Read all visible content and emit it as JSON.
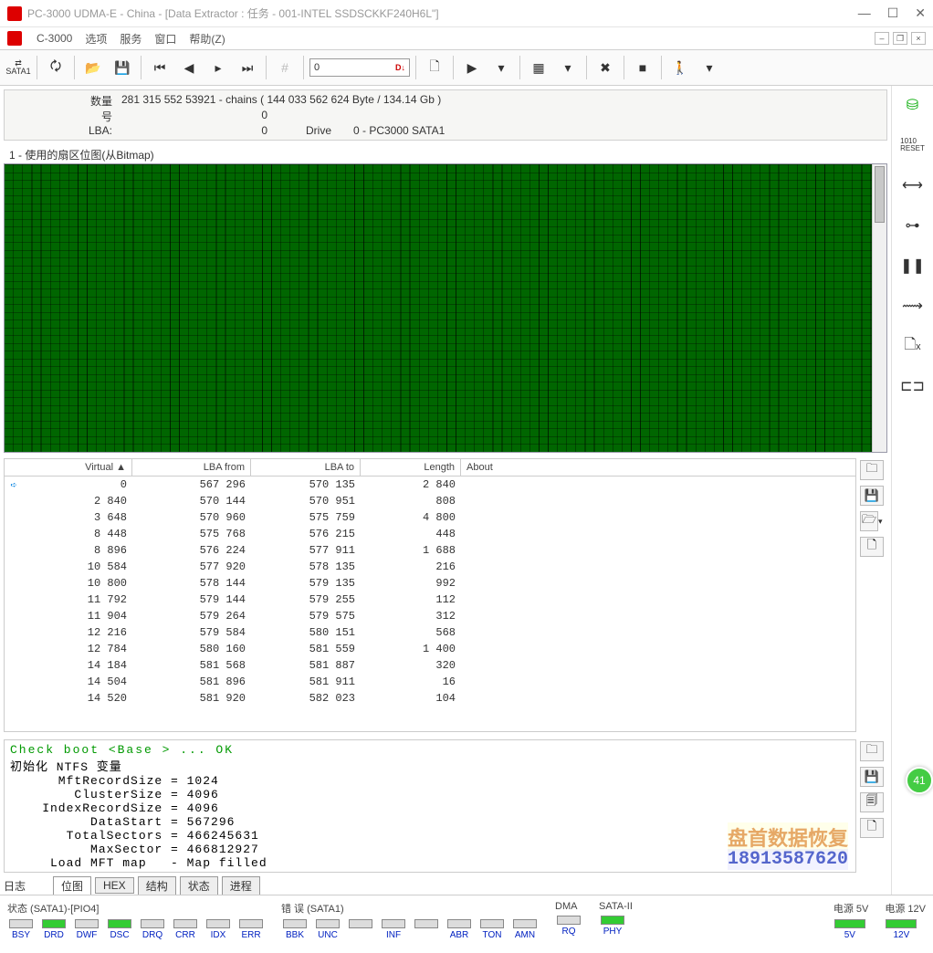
{
  "window": {
    "title": "PC-3000 UDMA-E - China - [Data Extractor : 任务 -           001-INTEL SSDSCKKF240H6L\"]",
    "btn_min": "—",
    "btn_max": "☐",
    "btn_close": "✕"
  },
  "menu": {
    "app": "C-3000",
    "options": "选项",
    "service": "服务",
    "window": "窗口",
    "help": "帮助(Z)"
  },
  "toolbar": {
    "sata": "SATA1",
    "lba_value": "0",
    "lba_suffix": "D↓"
  },
  "info": {
    "qty_label": "数量",
    "qty_value": "281 315 552   53921 - chains   ( 144 033 562 624 Byte /   134.14 Gb )",
    "hao_label": "号",
    "hao_value": "0",
    "lba_label": "LBA:",
    "lba_value": "0",
    "drive_label": "Drive",
    "drive_value": "0 - PC3000 SATA1"
  },
  "bitmap": {
    "title": "1 - 使用的扇区位图(从Bitmap)"
  },
  "table": {
    "headers": {
      "virtual": "Virtual ▲",
      "lba_from": "LBA from",
      "lba_to": "LBA to",
      "length": "Length",
      "about": "About"
    },
    "rows": [
      {
        "arrow": true,
        "virtual": "0",
        "from": "567 296",
        "to": "570 135",
        "len": "2 840"
      },
      {
        "arrow": false,
        "virtual": "2 840",
        "from": "570 144",
        "to": "570 951",
        "len": "808"
      },
      {
        "arrow": false,
        "virtual": "3 648",
        "from": "570 960",
        "to": "575 759",
        "len": "4 800"
      },
      {
        "arrow": false,
        "virtual": "8 448",
        "from": "575 768",
        "to": "576 215",
        "len": "448"
      },
      {
        "arrow": false,
        "virtual": "8 896",
        "from": "576 224",
        "to": "577 911",
        "len": "1 688"
      },
      {
        "arrow": false,
        "virtual": "10 584",
        "from": "577 920",
        "to": "578 135",
        "len": "216"
      },
      {
        "arrow": false,
        "virtual": "10 800",
        "from": "578 144",
        "to": "579 135",
        "len": "992"
      },
      {
        "arrow": false,
        "virtual": "11 792",
        "from": "579 144",
        "to": "579 255",
        "len": "112"
      },
      {
        "arrow": false,
        "virtual": "11 904",
        "from": "579 264",
        "to": "579 575",
        "len": "312"
      },
      {
        "arrow": false,
        "virtual": "12 216",
        "from": "579 584",
        "to": "580 151",
        "len": "568"
      },
      {
        "arrow": false,
        "virtual": "12 784",
        "from": "580 160",
        "to": "581 559",
        "len": "1 400"
      },
      {
        "arrow": false,
        "virtual": "14 184",
        "from": "581 568",
        "to": "581 887",
        "len": "320"
      },
      {
        "arrow": false,
        "virtual": "14 504",
        "from": "581 896",
        "to": "581 911",
        "len": "16"
      },
      {
        "arrow": false,
        "virtual": "14 520",
        "from": "581 920",
        "to": "582 023",
        "len": "104"
      }
    ]
  },
  "log": {
    "l1": "Check boot <Base   > ... OK",
    "l2": "初始化 NTFS 变量",
    "l3": "      MftRecordSize = 1024",
    "l4": "        ClusterSize = 4096",
    "l5": "    IndexRecordSize = 4096",
    "l6": "          DataStart = 567296",
    "l7": "       TotalSectors = 466245631",
    "l8": "          MaxSector = 466812927",
    "l9": "     Load MFT map   - Map filled",
    "watermark1": "盘首数据恢复",
    "watermark2": "18913587620"
  },
  "tabs": {
    "t0": "日志",
    "t1": "位图",
    "t2": "HEX",
    "t3": "结构",
    "t4": "状态",
    "t5": "进程"
  },
  "status": {
    "state_label": "状态 (SATA1)-[PIO4]",
    "error_label": "错 误 (SATA1)",
    "dma_label": "DMA",
    "sata2_label": "SATA-II",
    "p5_label": "电源 5V",
    "p12_label": "电源 12V",
    "leds": {
      "bsy": "BSY",
      "drd": "DRD",
      "dwf": "DWF",
      "dsc": "DSC",
      "drq": "DRQ",
      "crr": "CRR",
      "idx": "IDX",
      "err": "ERR",
      "bbk": "BBK",
      "unc": "UNC",
      "inf": "INF",
      "abr": "ABR",
      "ton": "TON",
      "amn": "AMN",
      "rq": "RQ",
      "phy": "PHY",
      "v5": "5V",
      "v12": "12V"
    }
  },
  "badge": "41"
}
